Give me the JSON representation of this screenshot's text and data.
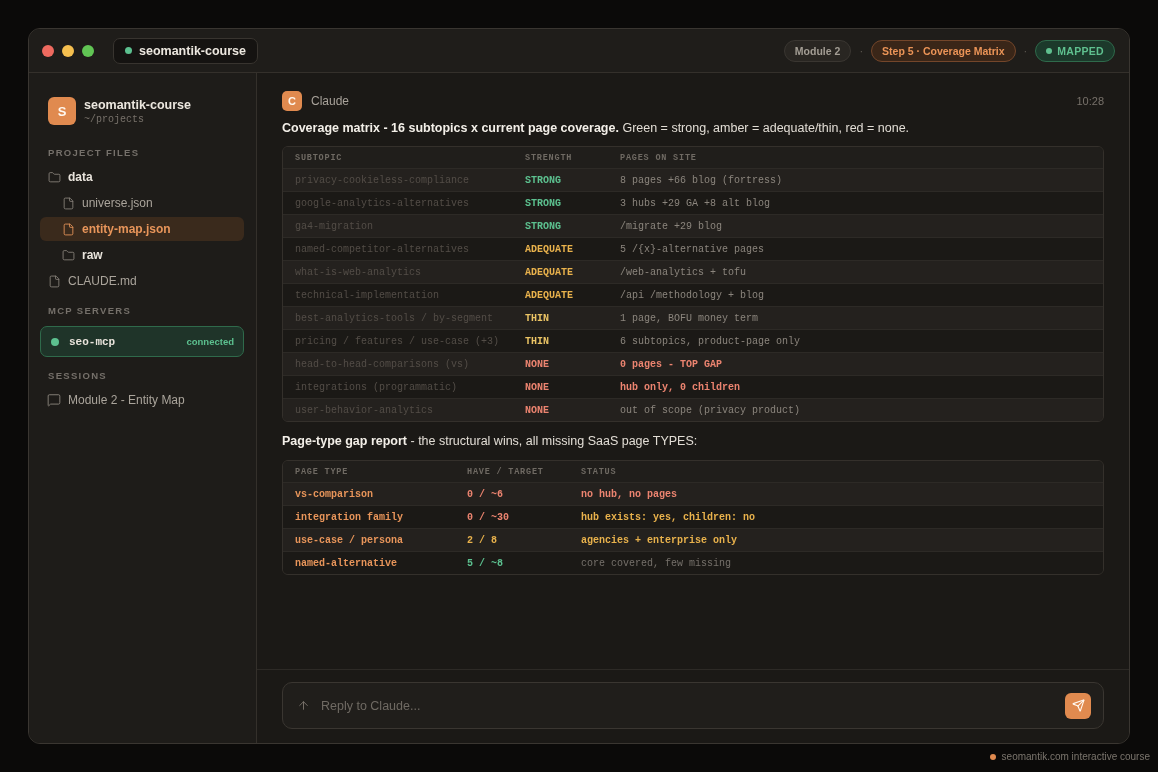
{
  "title_bar": {
    "project": "seomantik-course",
    "badges": [
      {
        "kind": "pill",
        "label": "Module 2"
      },
      {
        "kind": "separator",
        "label": "·"
      },
      {
        "kind": "accent",
        "label": "Step 5 · Coverage Matrix"
      },
      {
        "kind": "separator",
        "label": "·"
      },
      {
        "kind": "status",
        "label": "MAPPED"
      }
    ]
  },
  "sidebar": {
    "project": {
      "initial": "S",
      "name": "seomantik-course",
      "path": "~/projects"
    },
    "sections": [
      {
        "kind": "files",
        "title": "PROJECT FILES",
        "items": [
          {
            "kind": "folder",
            "label": "data",
            "selected": false,
            "children": [
              {
                "kind": "file",
                "label": "universe.json",
                "selected": false
              },
              {
                "kind": "file",
                "label": "entity-map.json",
                "selected": true
              },
              {
                "kind": "folder",
                "label": "raw",
                "selected": false
              }
            ]
          },
          {
            "kind": "file",
            "label": "CLAUDE.md",
            "selected": false
          }
        ]
      },
      {
        "kind": "servers",
        "title": "MCP SERVERS",
        "items": [
          {
            "label": "seo-mcp",
            "status": "connected",
            "connected": true
          }
        ]
      },
      {
        "kind": "sessions",
        "title": "SESSIONS",
        "items": [
          {
            "label": "Module 2 - Entity Map",
            "selected": false
          }
        ]
      }
    ]
  },
  "message": {
    "author": "Claude",
    "initial": "C",
    "time": "10:28",
    "intro": "**Coverage matrix - 16 subtopics x current page coverage.** Green = strong, amber = adequate/thin, red = none.",
    "coverage_table": {
      "columns": [
        "SUBTOPIC",
        "STRENGTH",
        "PAGES ON SITE"
      ],
      "rows": [
        {
          "subtopic": "privacy-cookieless-compliance",
          "strength": "STRONG",
          "kind": "strong",
          "pages": "8 pages +66 blog (fortress)",
          "flagged": false
        },
        {
          "subtopic": "google-analytics-alternatives",
          "strength": "STRONG",
          "kind": "strong",
          "pages": "3 hubs +29 GA +8 alt blog",
          "flagged": false
        },
        {
          "subtopic": "ga4-migration",
          "strength": "STRONG",
          "kind": "strong",
          "pages": "/migrate +29 blog",
          "flagged": false
        },
        {
          "subtopic": "named-competitor-alternatives",
          "strength": "ADEQUATE",
          "kind": "adequate",
          "pages": "5 /{x}-alternative pages",
          "flagged": false
        },
        {
          "subtopic": "what-is-web-analytics",
          "strength": "ADEQUATE",
          "kind": "adequate",
          "pages": "/web-analytics + tofu",
          "flagged": false
        },
        {
          "subtopic": "technical-implementation",
          "strength": "ADEQUATE",
          "kind": "adequate",
          "pages": "/api /methodology + blog",
          "flagged": false
        },
        {
          "subtopic": "best-analytics-tools / by-segment",
          "strength": "THIN",
          "kind": "thin",
          "pages": "1 page, BOFU money term",
          "flagged": false
        },
        {
          "subtopic": "pricing / features / use-case (+3)",
          "strength": "THIN",
          "kind": "thin",
          "pages": "6 subtopics, product-page only",
          "flagged": false
        },
        {
          "subtopic": "head-to-head-comparisons (vs)",
          "strength": "NONE",
          "kind": "none",
          "pages": "0 pages - TOP GAP",
          "flagged": true
        },
        {
          "subtopic": "integrations (programmatic)",
          "strength": "NONE",
          "kind": "none",
          "pages": "hub only, 0 children",
          "flagged": true
        },
        {
          "subtopic": "user-behavior-analytics",
          "strength": "NONE",
          "kind": "none",
          "pages": "out of scope (privacy product)",
          "flagged": false
        }
      ]
    },
    "gap_intro": "**Page-type gap report** - the structural wins, all missing SaaS page TYPES:",
    "gap_table": {
      "columns": [
        "PAGE TYPE",
        "HAVE / TARGET",
        "STATUS"
      ],
      "rows": [
        {
          "page_type": "vs-comparison",
          "have": {
            "text": "0 / ~6",
            "kind": "red"
          },
          "status": {
            "text": "no hub, no pages",
            "kind": "red"
          }
        },
        {
          "page_type": "integration family",
          "have": {
            "text": "0 / ~30",
            "kind": "red"
          },
          "status": {
            "text": "hub exists: yes, children: no",
            "kind": "amber"
          }
        },
        {
          "page_type": "use-case / persona",
          "have": {
            "text": "2 / 8",
            "kind": "amber"
          },
          "status": {
            "text": "agencies + enterprise only",
            "kind": "amber"
          }
        },
        {
          "page_type": "named-alternative",
          "have": {
            "text": "5 / ~8",
            "kind": "green"
          },
          "status": {
            "text": "core covered, few missing",
            "kind": "muted"
          }
        }
      ]
    }
  },
  "composer": {
    "placeholder": "Reply to Claude..."
  },
  "footer": {
    "text": "seomantik.com interactive course"
  }
}
